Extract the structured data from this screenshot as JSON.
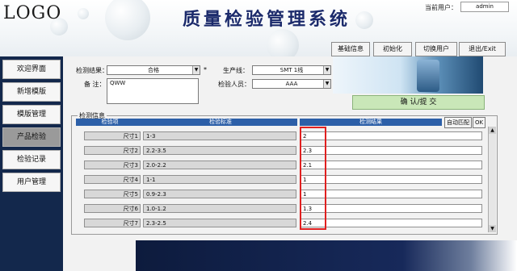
{
  "header": {
    "logo": "LOGO",
    "title": "质量检验管理系统",
    "user_label": "当前用户：",
    "user_value": "admin",
    "buttons": [
      "基础信息",
      "初始化",
      "切换用户",
      "退出/Exit"
    ]
  },
  "sidebar": {
    "items": [
      "欢迎界面",
      "新增模版",
      "模版管理",
      "产品检验",
      "检验记录",
      "用户管理"
    ],
    "active": "产品检验"
  },
  "form": {
    "result_label": "检测结果：",
    "result_value": "合格",
    "required_mark": "*",
    "line_label": "生产线：",
    "line_value": "SMT 1线",
    "remark_label": "备 注：",
    "remark_value": "QWW",
    "inspector_label": "检验人员：",
    "inspector_value": "AAA",
    "confirm_label": "确 认/提 交"
  },
  "table": {
    "group_title": "检测信息",
    "headers": [
      "检验项",
      "检验标准",
      "检测结果"
    ],
    "auto_match": "自动匹配",
    "ok": "OK",
    "rows": [
      {
        "item": "尺寸1",
        "standard": "1-3",
        "result": "2"
      },
      {
        "item": "尺寸2",
        "standard": "2.2-3.5",
        "result": "2.3"
      },
      {
        "item": "尺寸3",
        "standard": "2.0-2.2",
        "result": "2.1"
      },
      {
        "item": "尺寸4",
        "standard": "1-1",
        "result": "1"
      },
      {
        "item": "尺寸5",
        "standard": "0.9-2.3",
        "result": "1"
      },
      {
        "item": "尺寸6",
        "standard": "1.0-1.2",
        "result": "1.3"
      },
      {
        "item": "尺寸7",
        "standard": "2.3-2.5",
        "result": "2.4"
      }
    ]
  },
  "colors": {
    "sidebar": "#13284c",
    "title": "#1b2a6b",
    "header_bar": "#2c5fa8",
    "highlight": "#e02020",
    "confirm": "#c9e7b8"
  }
}
